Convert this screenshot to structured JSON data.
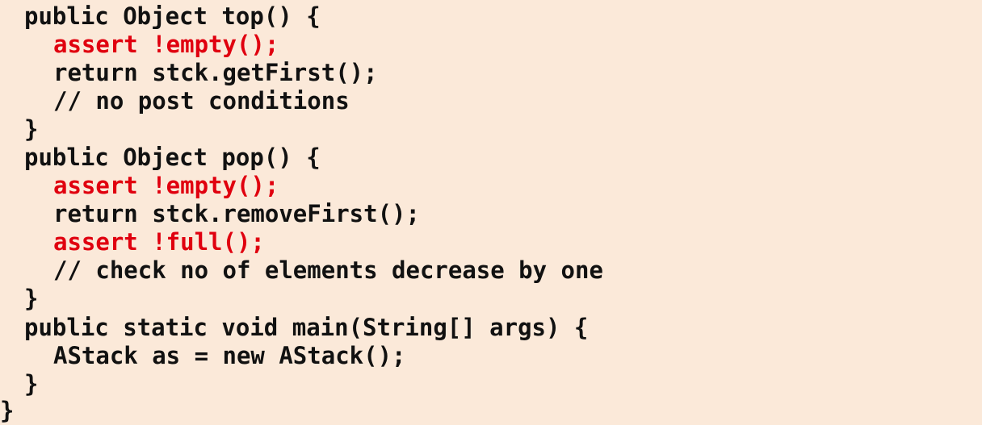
{
  "code": {
    "lines": [
      "public Object top() {",
      "assert !empty();",
      "return stck.getFirst();",
      "// no post conditions",
      "}",
      "public Object pop() {",
      "assert !empty();",
      "return stck.removeFirst();",
      "assert !full();",
      "// check no of elements decrease by one",
      "}",
      "public static void main(String[] args) {",
      "AStack as = new AStack();",
      "}",
      "}"
    ]
  },
  "colors": {
    "background": "#fbe9d9",
    "text": "#111111",
    "assert": "#e0000f"
  }
}
